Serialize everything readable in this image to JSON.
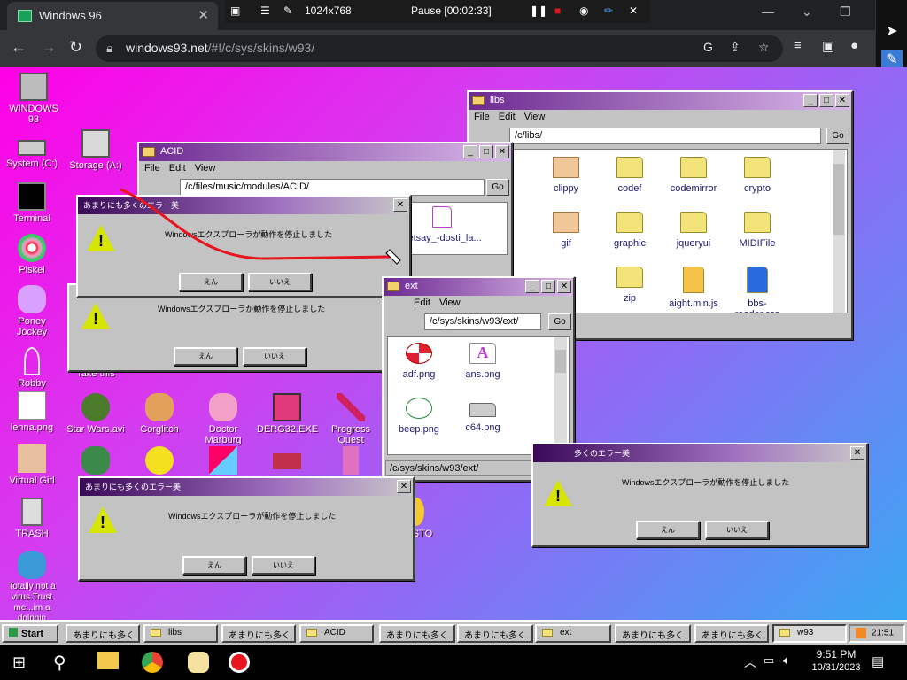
{
  "browser": {
    "tab_title": "Windows 96",
    "url_domain": "windows93.net",
    "url_path": "/#!/c/sys/skins/w93/",
    "recorder": {
      "resolution": "1024x768",
      "status": "Pause [00:02:33]"
    }
  },
  "desktop_icons": [
    {
      "name": "windows93",
      "label": "WINDOWS 93"
    },
    {
      "name": "system-c",
      "label": "System (C:)"
    },
    {
      "name": "storage-a",
      "label": "Storage (A:)"
    },
    {
      "name": "terminal",
      "label": "Terminal"
    },
    {
      "name": "piskel",
      "label": "Piskel"
    },
    {
      "name": "poney-jockey",
      "label": "Poney Jockey"
    },
    {
      "name": "robby",
      "label": "Robby"
    },
    {
      "name": "take-this",
      "label": "Take this"
    },
    {
      "name": "lenna",
      "label": "lenna.png"
    },
    {
      "name": "star-wars",
      "label": "Star Wars.avi"
    },
    {
      "name": "corglitch",
      "label": "Corglitch"
    },
    {
      "name": "doctor-marburg",
      "label": "Doctor Marburg"
    },
    {
      "name": "derg32",
      "label": "DERG32.EXE"
    },
    {
      "name": "progress-quest",
      "label": "Progress Quest"
    },
    {
      "name": "virtual-girl",
      "label": "Virtual Girl"
    },
    {
      "name": "trash",
      "label": "TRASH"
    },
    {
      "name": "totally-not-virus",
      "label": "Totally not a virus.Trust me...im a dolphin"
    },
    {
      "name": "manifesto",
      "label": "FESTO"
    }
  ],
  "windows": {
    "libs": {
      "title": "libs",
      "path": "/c/libs/",
      "menu": [
        "File",
        "Edit",
        "View"
      ],
      "go": "Go",
      "items": [
        "clippy",
        "codef",
        "codemirror",
        "crypto",
        "gif",
        "graphic",
        "jqueryui",
        "MIDIFile",
        "zip",
        "aight.min.js",
        "bbs-reader.css"
      ]
    },
    "acid": {
      "title": "ACID",
      "path": "/c/files/music/modules/ACID/",
      "menu": [
        "File",
        "Edit",
        "View"
      ],
      "go": "Go",
      "visible_file": "eetsay_-dosti_la..."
    },
    "ext": {
      "title": "ext",
      "path": "/c/sys/skins/w93/ext/",
      "menu": [
        "File",
        "Edit",
        "View"
      ],
      "go": "Go",
      "items": [
        "adf.png",
        "ans.png",
        "beep.png",
        "c64.png"
      ],
      "status": "/c/sys/skins/w93/ext/"
    }
  },
  "error_dialog": {
    "title": "あまりにも多くのエラー美",
    "title_partial": "多くのエラー美",
    "message": "Windowsエクスプローラが動作を停止しました",
    "yes": "えん",
    "no": "いいえ"
  },
  "taskbar": {
    "start": "Start",
    "items": [
      "あまりにも多く...",
      "libs",
      "あまりにも多く...",
      "ACID",
      "あまりにも多く...",
      "ext",
      "あまりにも多く...",
      "あまりにも多く...",
      "w93"
    ],
    "clock": "21:51"
  },
  "os_taskbar": {
    "time": "9:51 PM",
    "date": "10/31/2023"
  },
  "colors": {
    "accent": "#6d2a91",
    "pen": "#e8141e"
  }
}
